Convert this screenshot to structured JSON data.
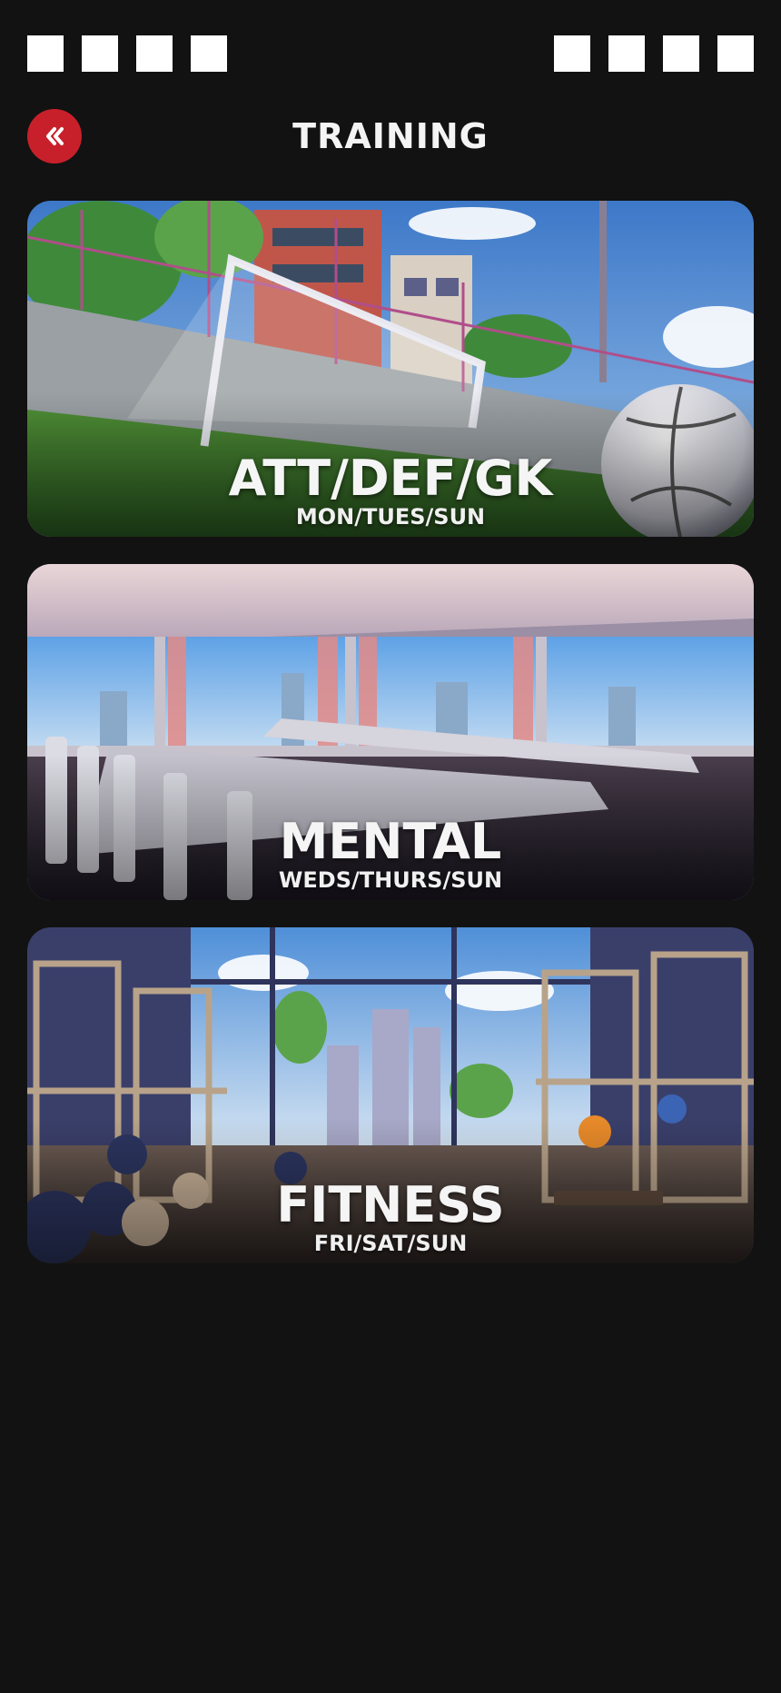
{
  "header": {
    "title": "TRAINING",
    "back_icon": "double-chevron-left-icon"
  },
  "colors": {
    "background": "#121212",
    "accent": "#c8202a",
    "text": "#ffffff"
  },
  "cards": [
    {
      "title": "ATT/DEF/GK",
      "subtitle": "MON/TUES/SUN",
      "scene": "football-pitch-illustration"
    },
    {
      "title": "MENTAL",
      "subtitle": "WEDS/THURS/SUN",
      "scene": "classroom-illustration"
    },
    {
      "title": "FITNESS",
      "subtitle": "FRI/SAT/SUN",
      "scene": "gym-illustration"
    }
  ]
}
